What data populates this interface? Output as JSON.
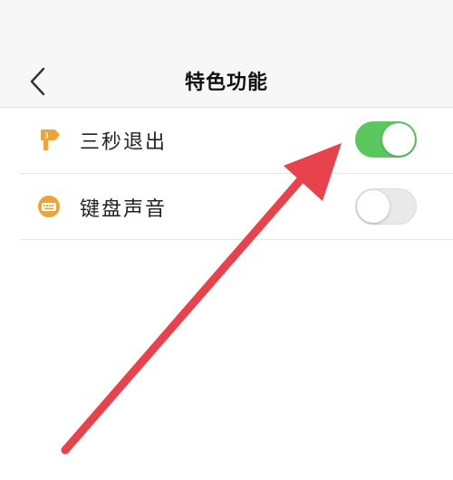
{
  "header": {
    "title": "特色功能",
    "back_icon": "chevron-left-icon"
  },
  "settings": [
    {
      "label": "三秒退出",
      "icon": "signpost-icon",
      "enabled": true
    },
    {
      "label": "键盘声音",
      "icon": "keyboard-icon",
      "enabled": false
    }
  ],
  "colors": {
    "toggle_on": "#5bc85f",
    "icon_orange": "#f1a232",
    "arrow_red": "#e8424d"
  }
}
